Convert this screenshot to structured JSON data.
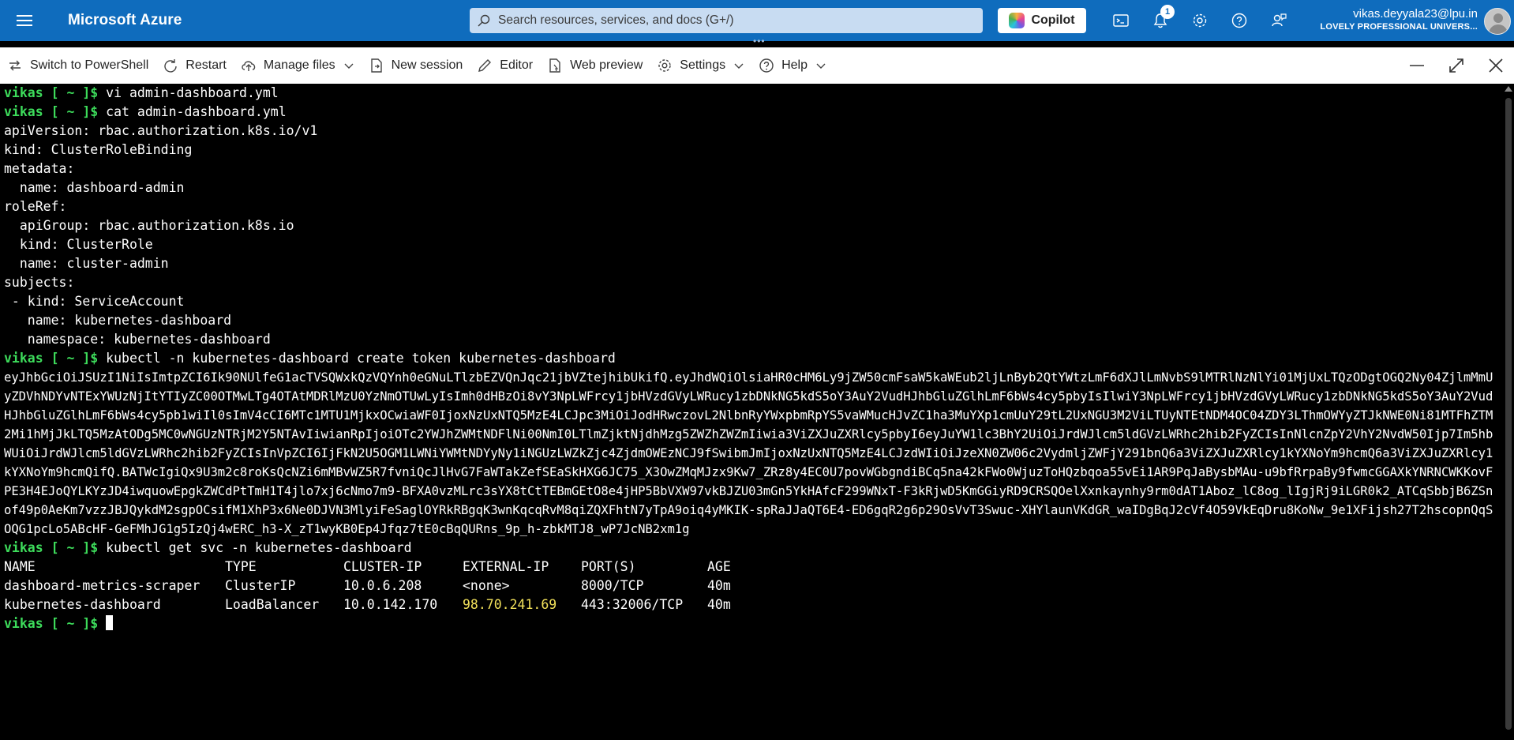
{
  "topbar": {
    "brand": "Microsoft Azure",
    "search_placeholder": "Search resources, services, and docs (G+/)",
    "copilot_label": "Copilot",
    "notification_count": "1",
    "user_email": "vikas.deyyala23@lpu.in",
    "user_org": "LOVELY PROFESSIONAL UNIVERS...",
    "brand_color": "#0f6cbd"
  },
  "toolbar": {
    "switch_shell": "Switch to PowerShell",
    "restart": "Restart",
    "manage_files": "Manage files",
    "new_session": "New session",
    "editor": "Editor",
    "web_preview": "Web preview",
    "settings": "Settings",
    "help": "Help"
  },
  "terminal": {
    "prompt": "vikas [ ~ ]$",
    "cmd_vi": " vi admin-dashboard.yml",
    "cmd_cat": " cat admin-dashboard.yml",
    "yaml": [
      "apiVersion: rbac.authorization.k8s.io/v1",
      "kind: ClusterRoleBinding",
      "metadata:",
      "  name: dashboard-admin",
      "roleRef:",
      "  apiGroup: rbac.authorization.k8s.io",
      "  kind: ClusterRole",
      "  name: cluster-admin",
      "subjects:",
      " - kind: ServiceAccount",
      "   name: kubernetes-dashboard",
      "   namespace: kubernetes-dashboard"
    ],
    "cmd_token": " kubectl -n kubernetes-dashboard create token kubernetes-dashboard",
    "token": "eyJhbGciOiJSUzI1NiIsImtpZCI6Ik90NUlfeG1acTVSQWxkQzVQYnh0eGNuLTlzbEZVQnJqc21jbVZtejhibUkifQ.eyJhdWQiOlsiaHR0cHM6Ly9jZW50cmFsaW5kaWEub2ljLnByb2QtYWtzLmF6dXJlLmNvbS9lMTRlNzNlYi01MjUxLTQzODgtOGQ2Ny04ZjlmMmUyZDVhNDYvNTExYWUzNjItYTIyZC00OTMwLTg4OTAtMDRlMzU0YzNmOTUwLyIsImh0dHBzOi8vY3NpLWFrcy1jbHVzdGVyLWRucy1zbDNkNG5kdS5oY3AuY2VudHJhbGluZGlhLmF6bWs4cy5pbyIsIlwiY3NpLWFrcy1jbHVzdGVyLWRucy1zbDNkNG5kdS5oY3AuY2VudHJhbGluZGlhLmF6bWs4cy5pb1wiIl0sImV4cCI6MTc1MTU1MjkxOCwiaWF0IjoxNzUxNTQ5MzE4LCJpc3MiOiJodHRwczovL2NlbnRyYWxpbmRpYS5vaWMucHJvZC1ha3MuYXp1cmUuY29tL2UxNGU3M2ViLTUyNTEtNDM4OC04ZDY3LThmOWYyZTJkNWE0Ni81MTFhZTM2Mi1hMjJkLTQ5MzAtODg5MC0wNGUzNTRjM2Y5NTAvIiwianRpIjoiOTc2YWJhZWMtNDFlNi00NmI0LTlmZjktNjdhMzg5ZWZhZWZmIiwia3ViZXJuZXRlcy5pbyI6eyJuYW1lc3BhY2UiOiJrdWJlcm5ldGVzLWRhc2hib2FyZCIsInNlcnZpY2VhY2NvdW50Ijp7Im5hbWUiOiJrdWJlcm5ldGVzLWRhc2hib2FyZCIsInVpZCI6IjFkN2U5OGM1LWNiYWMtNDYyNy1iNGUzLWZkZjc4ZjdmOWEzNCJ9fSwibmJmIjoxNzUxNTQ5MzE4LCJzdWIiOiJzeXN0ZW06c2VydmljZWFjY291bnQ6a3ViZXJuZXRlcy1kYXNoYm9hcmQ6a3ViZXJuZXRlcy1kYXNoYm9hcmQifQ.BATWcIgiQx9U3m2c8roKsQcNZi6mMBvWZ5R7fvniQcJlHvG7FaWTakZefSEaSkHXG6JC75_X3OwZMqMJzx9Kw7_ZRz8y4EC0U7povWGbgndiBCq5na42kFWo0WjuzToHQzbqoa55vEi1AR9PqJaBysbMAu-u9bfRrpaBy9fwmcGGAXkYNRNCWKKovFPE3H4EJoQYLKYzJD4iwquowEpgkZWCdPtTmH1T4jlo7xj6cNmo7m9-BFXA0vzMLrc3sYX8tCtTEBmGEtO8e4jHP5BbVXW97vkBJZU03mGn5YkHAfcF299WNxT-F3kRjwD5KmGGiyRD9CRSQOelXxnkaynhy9rm0dAT1Aboz_lC8og_lIgjRj9iLGR0k2_ATCqSbbjB6ZSnof49p0AeKm7vzzJBJQykdM2sgpOCsifM1XhP3x6Ne0DJVN3MlyiFeSaglOYRkRBgqK3wnKqcqRvM8qiZQXFhtN7yTpA9oiq4yMKIK-spRaJJaQT6E4-ED6gqR2g6p29OsVvT3Swuc-XHYlaunVKdGR_waIDgBqJ2cVf4O59VkEqDru8KoNw_9e1XFijsh27T2hscopnQqSOQG1pcLo5ABcHF-GeFMhJG1g5IzQj4wERC_h3-X_zT1wyKB0Ep4Jfqz7tE0cBqQURns_9p_h-zbkMTJ8_wP7JcNB2xm1g",
    "cmd_svc": " kubectl get svc -n kubernetes-dashboard",
    "svc_table": {
      "headers": [
        "NAME",
        "TYPE",
        "CLUSTER-IP",
        "EXTERNAL-IP",
        "PORT(S)",
        "AGE"
      ],
      "rows": [
        [
          "dashboard-metrics-scraper",
          "ClusterIP",
          "10.0.6.208",
          "<none>",
          "8000/TCP",
          "40m"
        ],
        [
          "kubernetes-dashboard",
          "LoadBalancer",
          "10.0.142.170",
          "98.70.241.69",
          "443:32006/TCP",
          "40m"
        ]
      ]
    },
    "prompt_color": "#3ddc5b",
    "external_ip_color": "#f1e05a"
  }
}
